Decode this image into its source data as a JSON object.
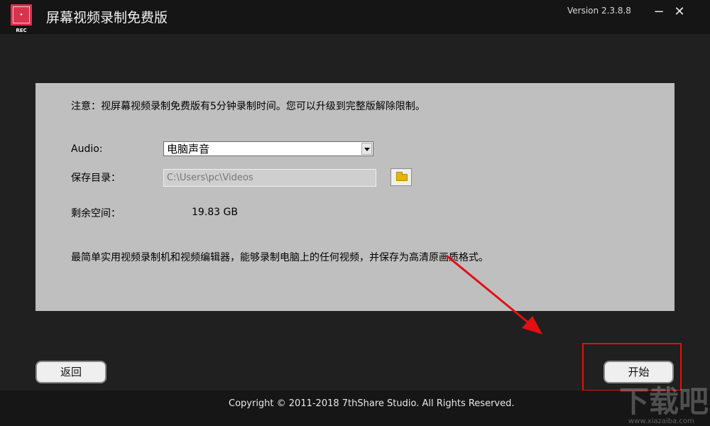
{
  "window": {
    "app_title": "屏幕视频录制免费版",
    "version": "Version 2.3.8.8",
    "minimize_symbol": "−",
    "close_symbol": "✕",
    "logo_text": "• REC"
  },
  "main": {
    "notice": "注意：视屏幕视频录制免费版有5分钟录制时间。您可以升级到完整版解除限制。",
    "audio_label": "Audio:",
    "audio_selected": "电脑声音",
    "save_dir_label": "保存目录：",
    "save_dir_value": "C:\\Users\\pc\\Videos",
    "free_space_label": "剩余空间：",
    "free_space_value": "19.83 GB",
    "description": "最简单实用视频录制机和视频编辑器，能够录制电脑上的任何视频，并保存为高清原画质格式。"
  },
  "buttons": {
    "back_label": "返回",
    "start_label": "开始"
  },
  "footer": {
    "copyright": "Copyright © 2011-2018 7thShare Studio. All Rights Reserved."
  },
  "watermark": {
    "main": "下载吧",
    "sub": "www.xiazaiba.com"
  },
  "colors": {
    "title_bar": "#151515",
    "background": "#202020",
    "panel": "#bfbfbf",
    "highlight": "#e20f13",
    "logo": "#d9334d"
  },
  "icons": [
    "logo-rec-icon",
    "minimize-icon",
    "close-icon",
    "folder-icon",
    "dropdown-arrow-icon",
    "red-arrow-annotation"
  ]
}
